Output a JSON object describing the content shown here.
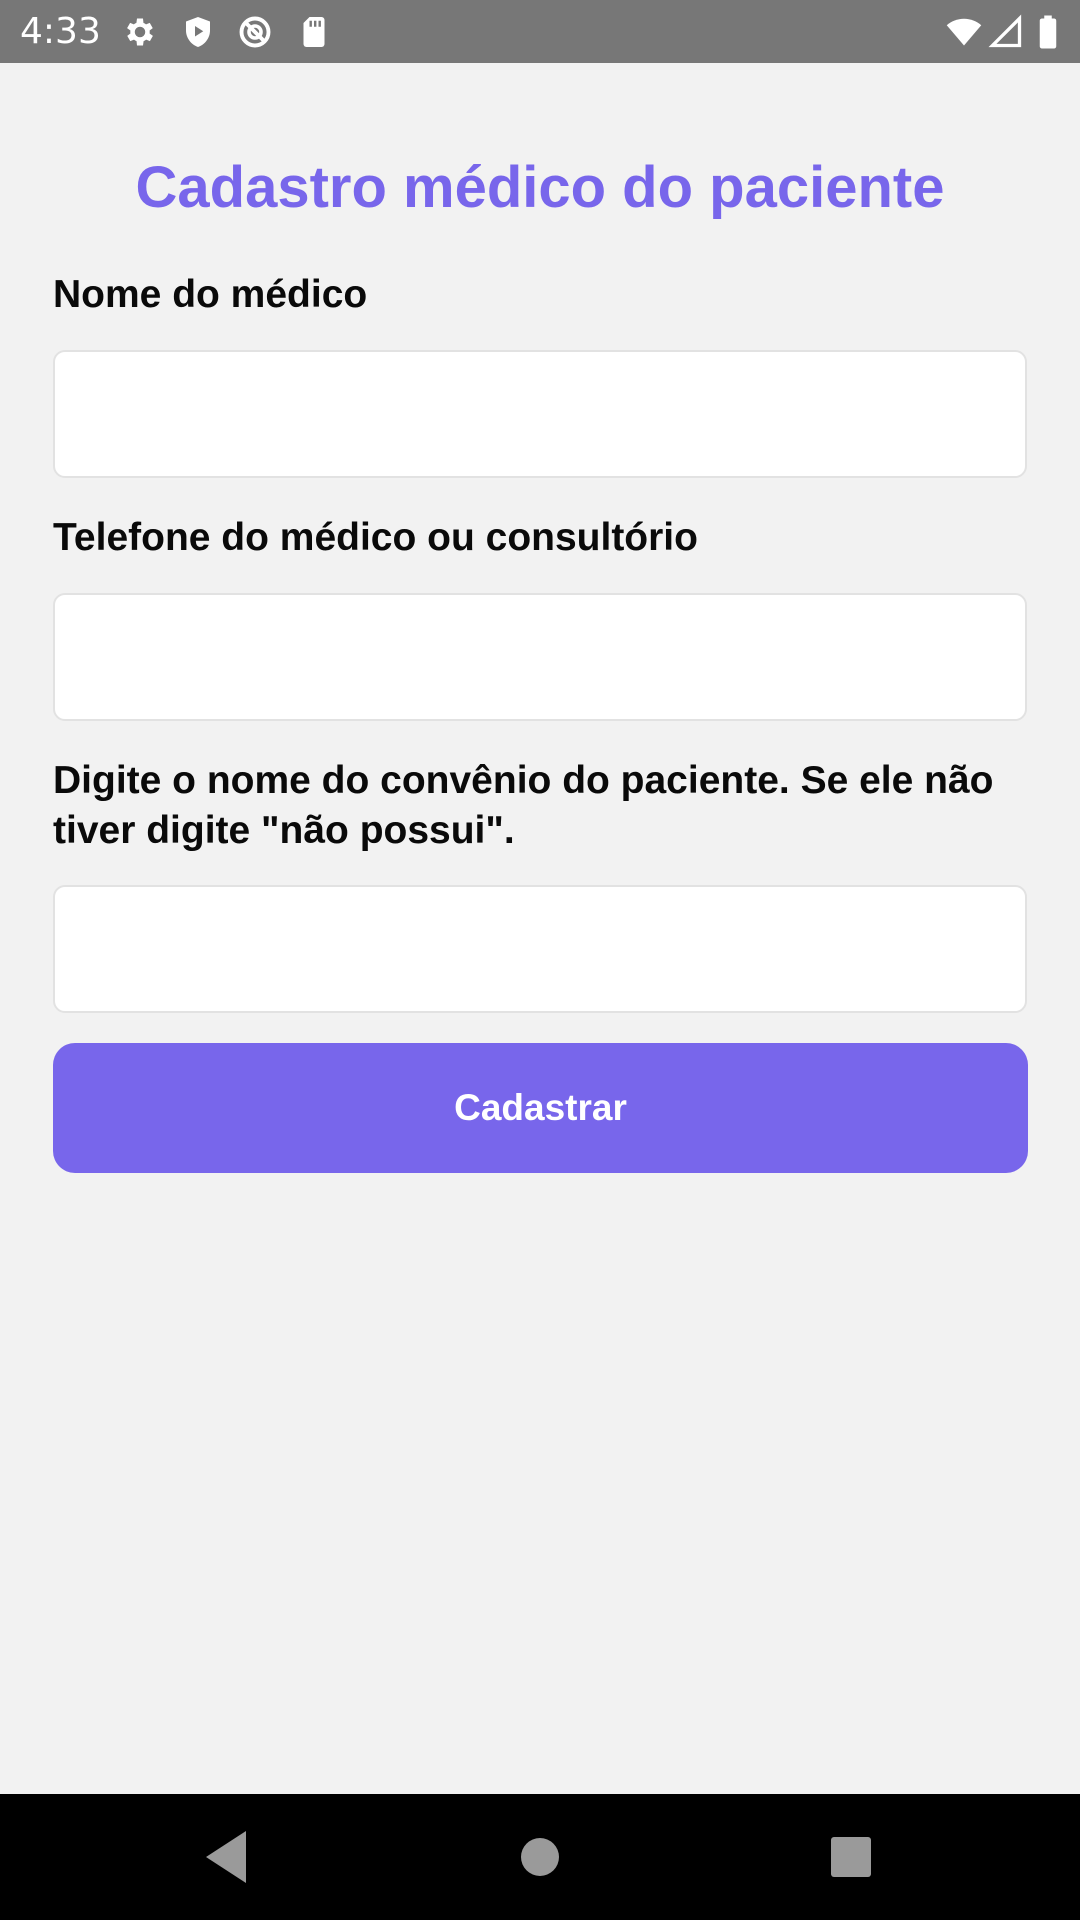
{
  "status_bar": {
    "time": "4:33",
    "left_icons": [
      "gear-icon",
      "shield-play-icon",
      "no-sync-icon",
      "sd-card-icon"
    ],
    "right_icons": [
      "wifi-icon",
      "signal-icon",
      "battery-icon"
    ],
    "background": "#777777"
  },
  "form": {
    "title": "Cadastro médico do paciente",
    "fields": [
      {
        "label": "Nome do médico",
        "value": "",
        "placeholder": ""
      },
      {
        "label": "Telefone do médico ou consultório",
        "value": "",
        "placeholder": ""
      },
      {
        "label": "Digite o nome do convênio do paciente. Se ele não tiver digite \"não possui\".",
        "value": "",
        "placeholder": ""
      }
    ],
    "submit_label": "Cadastrar"
  },
  "nav_bar": {
    "buttons": [
      "back-icon",
      "home-icon",
      "recents-icon"
    ]
  },
  "colors": {
    "accent": "#7866eb",
    "background": "#f2f2f2",
    "input_background": "#ffffff",
    "input_border": "#e2e2e2"
  }
}
